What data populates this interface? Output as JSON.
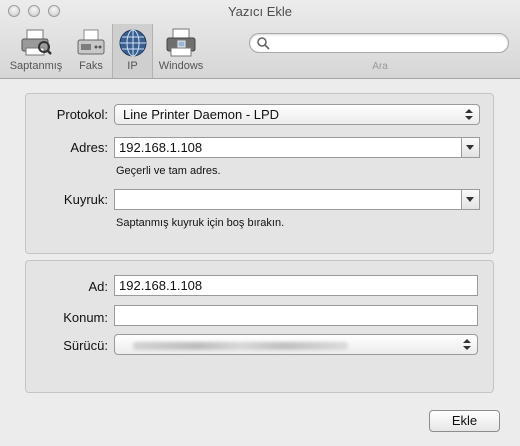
{
  "window": {
    "title": "Yazıcı Ekle"
  },
  "toolbar": {
    "items": [
      {
        "label": "Saptanmış",
        "icon": "default-printer-icon"
      },
      {
        "label": "Faks",
        "icon": "fax-icon"
      },
      {
        "label": "IP",
        "icon": "globe-icon",
        "selected": true
      },
      {
        "label": "Windows",
        "icon": "windows-printer-icon"
      }
    ],
    "search": {
      "placeholder": "",
      "label": "Ara",
      "icon": "search-icon"
    }
  },
  "connection": {
    "protocol_label": "Protokol:",
    "protocol_value": "Line Printer Daemon - LPD",
    "address_label": "Adres:",
    "address_value": "192.168.1.108",
    "address_hint": "Geçerli ve tam adres.",
    "queue_label": "Kuyruk:",
    "queue_value": "",
    "queue_hint": "Saptanmış kuyruk için boş bırakın."
  },
  "printer": {
    "name_label": "Ad:",
    "name_value": "192.168.1.108",
    "location_label": "Konum:",
    "location_value": "",
    "driver_label": "Sürücü:",
    "driver_value": ""
  },
  "actions": {
    "add_label": "Ekle"
  }
}
